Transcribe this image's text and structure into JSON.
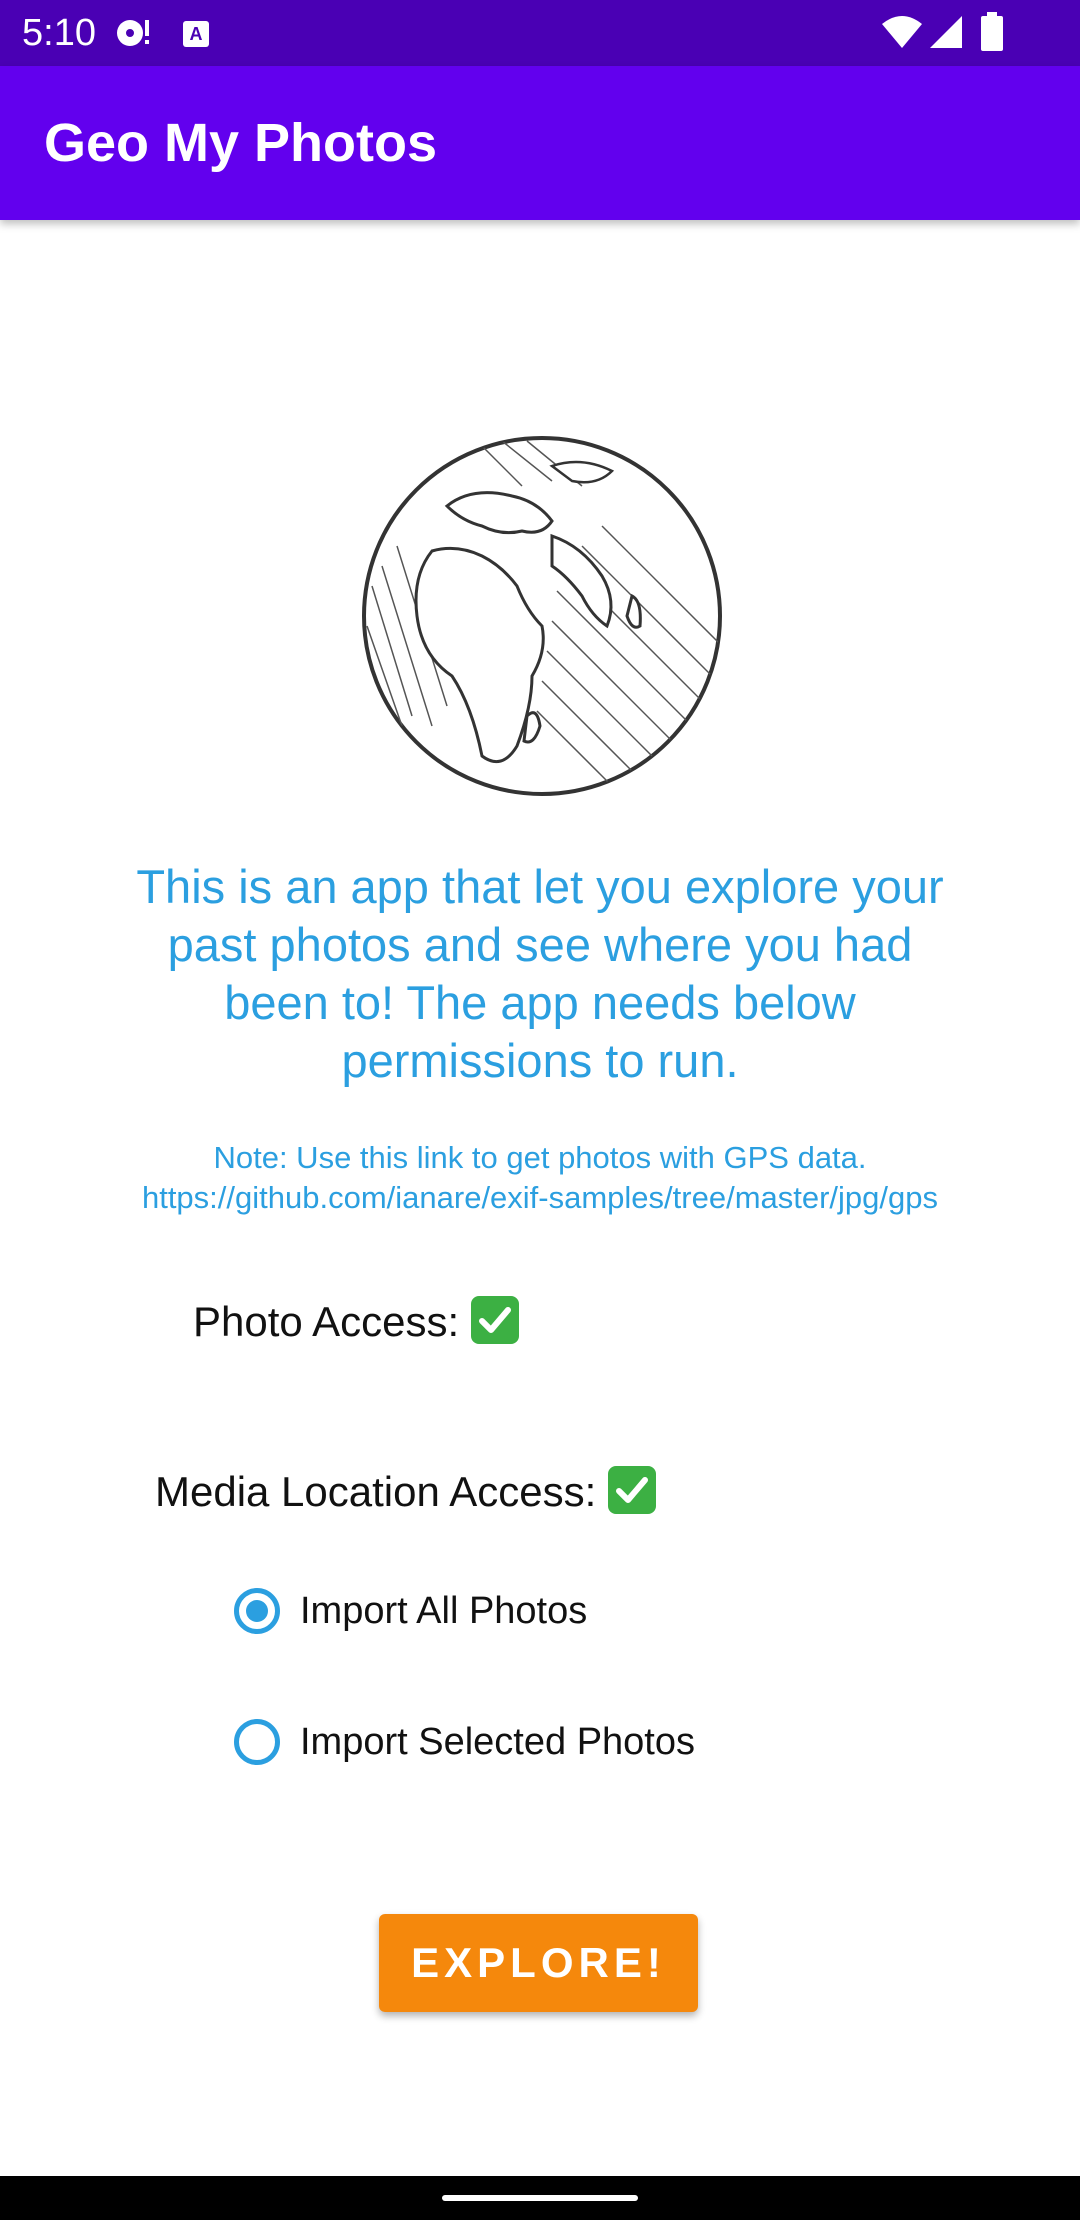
{
  "status_bar": {
    "time": "5:10",
    "icons_left": [
      "media-icon",
      "text-input-icon"
    ],
    "icons_right": [
      "wifi-icon",
      "signal-icon",
      "battery-icon"
    ]
  },
  "app_bar": {
    "title": "Geo My Photos",
    "color": "#6200ee"
  },
  "hero": {
    "icon": "globe-icon"
  },
  "intro_text": "This is an app that let you explore your past photos and see where you had been to! The app needs below permissions to run.",
  "note_text": "Note: Use this link to get photos with GPS data. https://github.com/ianare/exif-samples/tree/master/jpg/gps",
  "permissions": {
    "photo_access": {
      "label": "Photo Access:",
      "status_icon": "check-icon"
    },
    "media_location_access": {
      "label": "Media Location Access:",
      "status_icon": "check-icon"
    }
  },
  "import_options": [
    {
      "label": "Import All Photos",
      "selected": true
    },
    {
      "label": "Import Selected Photos",
      "selected": false
    }
  ],
  "explore_button": {
    "label": "EXPLORE!",
    "color": "#f5880c"
  },
  "accent_color": "#2b9fe0"
}
